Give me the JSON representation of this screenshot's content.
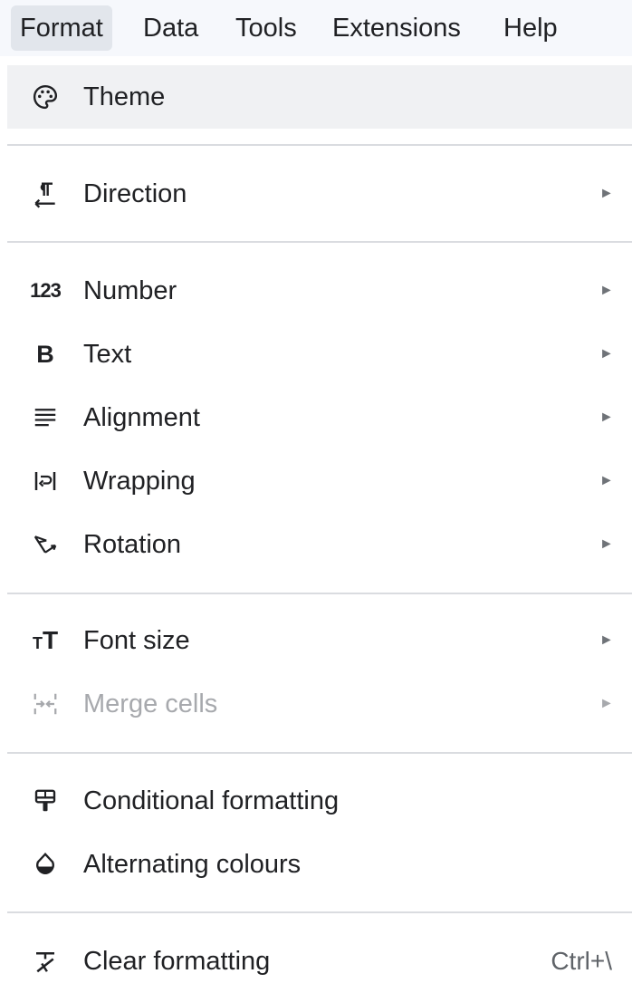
{
  "menubar": {
    "items": [
      {
        "label": "Format"
      },
      {
        "label": "Data"
      },
      {
        "label": "Tools"
      },
      {
        "label": "Extensions"
      },
      {
        "label": "Help"
      }
    ]
  },
  "format_menu": {
    "items": {
      "theme": {
        "label": "Theme",
        "icon": "palette-icon",
        "has_submenu": false
      },
      "direction": {
        "label": "Direction",
        "icon": "text-direction-icon",
        "has_submenu": true
      },
      "number": {
        "label": "Number",
        "icon": "number-123-icon",
        "has_submenu": true
      },
      "text": {
        "label": "Text",
        "icon": "bold-icon",
        "has_submenu": true
      },
      "alignment": {
        "label": "Alignment",
        "icon": "align-left-icon",
        "has_submenu": true
      },
      "wrapping": {
        "label": "Wrapping",
        "icon": "wrap-text-icon",
        "has_submenu": true
      },
      "rotation": {
        "label": "Rotation",
        "icon": "text-rotation-icon",
        "has_submenu": true
      },
      "font_size": {
        "label": "Font size",
        "icon": "font-size-icon",
        "has_submenu": true
      },
      "merge_cells": {
        "label": "Merge cells",
        "icon": "merge-cells-icon",
        "has_submenu": true,
        "disabled": true
      },
      "conditional_formatting": {
        "label": "Conditional formatting",
        "icon": "paint-roller-icon",
        "has_submenu": false
      },
      "alternating_colours": {
        "label": "Alternating colours",
        "icon": "color-drop-icon",
        "has_submenu": false
      },
      "clear_formatting": {
        "label": "Clear formatting",
        "icon": "clear-format-icon",
        "shortcut": "Ctrl+\\",
        "has_submenu": false
      }
    },
    "submenu_arrow": "►"
  },
  "colors": {
    "menubar_bg": "#f6f8fc",
    "active_top_item": "#e2e6ec",
    "hover_row": "#f0f1f3",
    "separator": "#dadce0",
    "disabled_text": "#a7a9ad"
  }
}
